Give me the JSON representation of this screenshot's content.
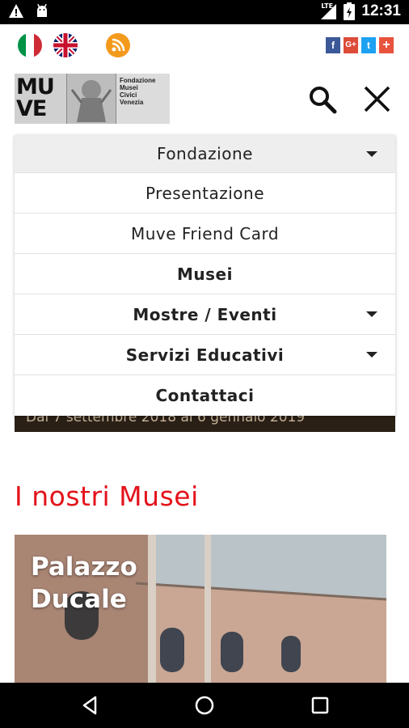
{
  "status_bar": {
    "network": "LTE",
    "time": "12:31",
    "icons": [
      "warning-icon",
      "android-icon",
      "signal-icon",
      "battery-icon"
    ]
  },
  "top_strip": {
    "flags": [
      "italian-flag",
      "uk-flag"
    ],
    "rss": "rss-icon",
    "social": [
      {
        "name": "facebook",
        "label": "f",
        "color": "#3b5998"
      },
      {
        "name": "google-plus",
        "label": "G+",
        "color": "#dd4b39"
      },
      {
        "name": "twitter",
        "label": "t",
        "color": "#1da1f2"
      },
      {
        "name": "share",
        "label": "+",
        "color": "#e8533e"
      }
    ]
  },
  "logo": {
    "brand": "MU VE",
    "lines": [
      "Fondazione",
      "Musei",
      "Civici",
      "Venezia"
    ]
  },
  "menu": {
    "items": [
      {
        "label": "Fondazione",
        "submenu": true
      },
      {
        "label": "Presentazione",
        "submenu": false
      },
      {
        "label": "Muve Friend Card",
        "submenu": false
      },
      {
        "label": "Musei",
        "submenu": false
      },
      {
        "label": "Mostre / Eventi",
        "submenu": true
      },
      {
        "label": "Servizi Educativi",
        "submenu": true
      },
      {
        "label": "Contattaci",
        "submenu": false
      }
    ]
  },
  "banner": {
    "text": "Dal 7 settembre 2018 al 6 gennaio 2019"
  },
  "section": {
    "title": "I nostri Musei"
  },
  "museum_card": {
    "title_line1": "Palazzo",
    "title_line2": "Ducale"
  },
  "colors": {
    "accent_red": "#e3121b",
    "rss_orange": "#f39a1d"
  }
}
